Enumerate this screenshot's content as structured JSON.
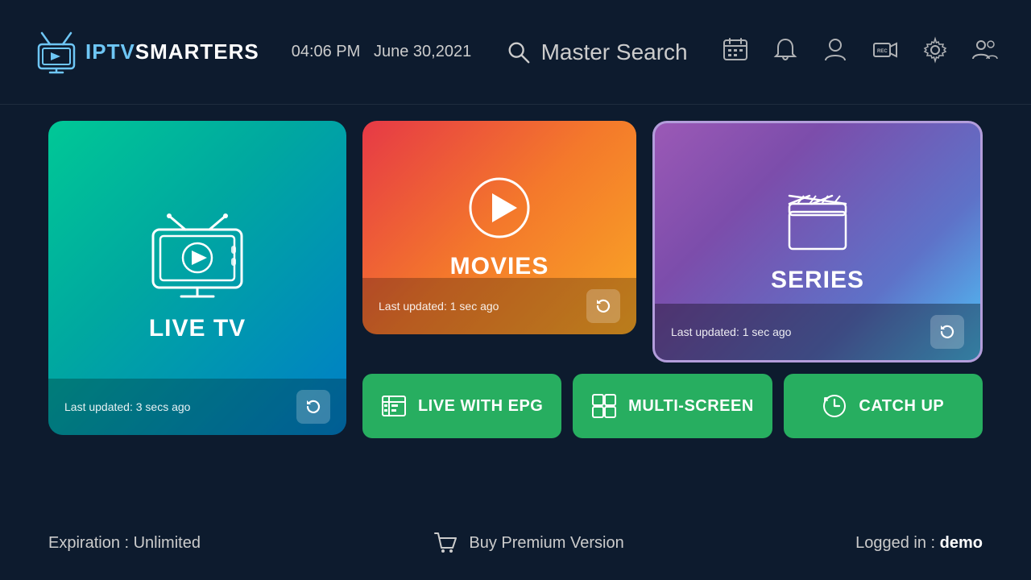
{
  "header": {
    "logo_iptv": "IPTV",
    "logo_smarters": "SMARTERS",
    "time": "04:06 PM",
    "date": "June 30,2021",
    "search_label": "Master Search"
  },
  "cards": {
    "live_tv": {
      "title": "LIVE TV",
      "last_updated": "Last updated: 3 secs ago"
    },
    "movies": {
      "title": "MOVIES",
      "last_updated": "Last updated: 1 sec ago"
    },
    "series": {
      "title": "SERIES",
      "last_updated": "Last updated: 1 sec ago"
    }
  },
  "small_buttons": {
    "epg": "LIVE WITH EPG",
    "multiscreen": "MULTI-SCREEN",
    "catchup": "CATCH UP"
  },
  "footer": {
    "expiration_label": "Expiration : Unlimited",
    "buy_premium": "Buy Premium Version",
    "logged_in_label": "Logged in : ",
    "logged_in_user": "demo"
  }
}
